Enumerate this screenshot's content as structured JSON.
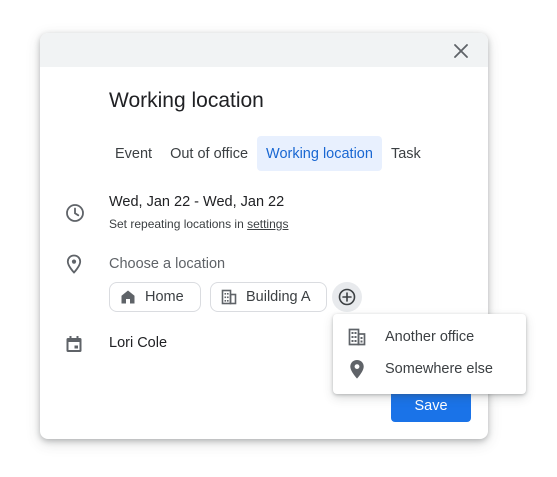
{
  "dialog": {
    "title": "Working location",
    "tabs": [
      {
        "label": "Event",
        "active": false
      },
      {
        "label": "Out of office",
        "active": false
      },
      {
        "label": "Working location",
        "active": true
      },
      {
        "label": "Task",
        "active": false
      }
    ],
    "date_range": "Wed, Jan 22 - Wed, Jan 22",
    "repeat_prefix": "Set repeating locations in ",
    "repeat_link": "settings",
    "location_label": "Choose a location",
    "chips": [
      {
        "label": "Home",
        "icon": "home-icon"
      },
      {
        "label": "Building A",
        "icon": "building-icon"
      }
    ],
    "owner": "Lori Cole",
    "save_label": "Save"
  },
  "location_menu": {
    "items": [
      {
        "label": "Another office",
        "icon": "building-icon"
      },
      {
        "label": "Somewhere else",
        "icon": "location-pin-icon"
      }
    ]
  },
  "colors": {
    "accent": "#1a73e8",
    "active_tab_bg": "#e8f0fe",
    "active_tab_text": "#1967d2",
    "header_bg": "#f1f3f4"
  }
}
